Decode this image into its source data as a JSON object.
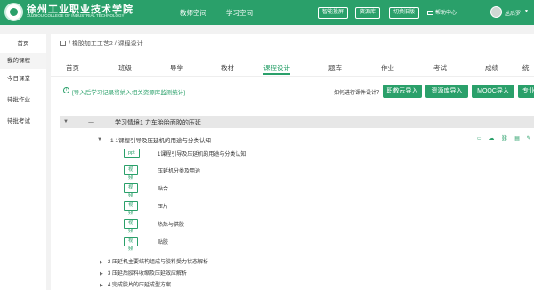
{
  "header": {
    "school_name": "徐州工业职业技术学院",
    "school_name_en": "XUZHOU COLLEGE OF INDUSTRIAL TECHNOLOGY",
    "nav": [
      "教师空间",
      "学习空间"
    ],
    "buttons": [
      "智能投屏",
      "资源库",
      "切换旧版"
    ],
    "message": "帮助中心",
    "username": "丛后罗"
  },
  "sidebar": {
    "items": [
      "首页",
      "我的课程",
      "今日课堂",
      "待批作业",
      "待批考试"
    ]
  },
  "breadcrumb": {
    "text": "/ 橡胶加工工艺2 / 课程设计"
  },
  "tabs": [
    "首页",
    "班级",
    "导学",
    "教材",
    "课程设计",
    "题库",
    "作业",
    "考试",
    "成绩",
    "统"
  ],
  "toolbar": {
    "info": "[导入后学习记录将纳入相关资源库监测统计]",
    "howto": "如何进行课件设计？",
    "buttons": [
      "职教云导入",
      "资源库导入",
      "MOOC导入",
      "专业"
    ]
  },
  "chapter": {
    "dash": "一",
    "title": "学习情境1 力车胎胎面胶的压延"
  },
  "section": {
    "title": "1 1课程引导及压延机的用途与分类认知",
    "icons": "▭ ☁ ⛓ ▤ ✎"
  },
  "resources": [
    {
      "type": "ppt",
      "name": "1课程引导及压延机的用途与分类认知"
    },
    {
      "type": "视频",
      "name": "压延机分类及用途"
    },
    {
      "type": "视频",
      "name": "贴合"
    },
    {
      "type": "视频",
      "name": "压片"
    },
    {
      "type": "视频",
      "name": "热炼与供胶"
    },
    {
      "type": "视频",
      "name": "贴胶"
    }
  ],
  "subsections": [
    "2 压延机主要结构组成与胶料受力状态解析",
    "3 压延后胶料收缩及压延效应解析",
    "4 完成胶片的压延成型方案"
  ]
}
